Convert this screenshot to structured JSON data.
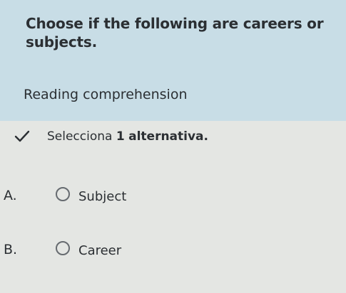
{
  "question": {
    "title": "Choose if the following are careers or subjects.",
    "prompt": "Reading comprehension"
  },
  "instruction": {
    "prefix": "Selecciona",
    "count": "1",
    "suffix": "alternativa."
  },
  "options": [
    {
      "letter": "A.",
      "label": "Subject"
    },
    {
      "letter": "B.",
      "label": "Career"
    }
  ],
  "colors": {
    "header_bg": "#c8dde6",
    "page_bg": "#e4e6e3",
    "text": "#2b2f33",
    "radio_border": "#666b70"
  }
}
